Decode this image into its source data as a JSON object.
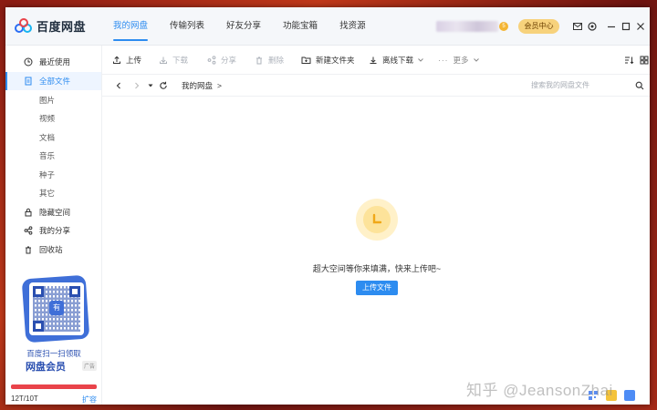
{
  "app": {
    "name": "百度网盘"
  },
  "nav": {
    "tabs": [
      "我的网盘",
      "传输列表",
      "好友分享",
      "功能宝箱",
      "找资源"
    ],
    "active_index": 0
  },
  "header": {
    "vip_level": "5",
    "vip_button": "会员中心"
  },
  "toolbar": {
    "upload": "上传",
    "download": "下载",
    "share": "分享",
    "delete": "删除",
    "new_folder": "新建文件夹",
    "offline_download": "离线下载",
    "more": "更多"
  },
  "address": {
    "breadcrumb": "我的网盘",
    "separator": ">",
    "search_placeholder": "搜索我的网盘文件"
  },
  "sidebar": {
    "items": [
      {
        "label": "最近使用",
        "icon": "clock-icon",
        "type": "main"
      },
      {
        "label": "全部文件",
        "icon": "file-icon",
        "type": "main",
        "active": true
      },
      {
        "label": "图片",
        "type": "sub"
      },
      {
        "label": "视频",
        "type": "sub"
      },
      {
        "label": "文档",
        "type": "sub"
      },
      {
        "label": "音乐",
        "type": "sub"
      },
      {
        "label": "种子",
        "type": "sub"
      },
      {
        "label": "其它",
        "type": "sub"
      },
      {
        "label": "隐藏空间",
        "icon": "lock-icon",
        "type": "main"
      },
      {
        "label": "我的分享",
        "icon": "share-icon",
        "type": "main"
      },
      {
        "label": "回收站",
        "icon": "trash-icon",
        "type": "main"
      }
    ],
    "promo": {
      "line1": "百度扫一扫领取",
      "line2": "网盘会员",
      "tag": "广告",
      "qr_center": "有"
    },
    "storage": {
      "text": "12T/10T",
      "expand": "扩容",
      "used_fraction": 1.0
    }
  },
  "empty_state": {
    "message": "超大空间等你来填满，快来上传吧~",
    "button": "上传文件"
  },
  "watermark": "知乎 @JeansonZhai",
  "colors": {
    "accent": "#2d8cf0",
    "vip": "#f7d27c",
    "storage_bar": "#e9434a"
  }
}
